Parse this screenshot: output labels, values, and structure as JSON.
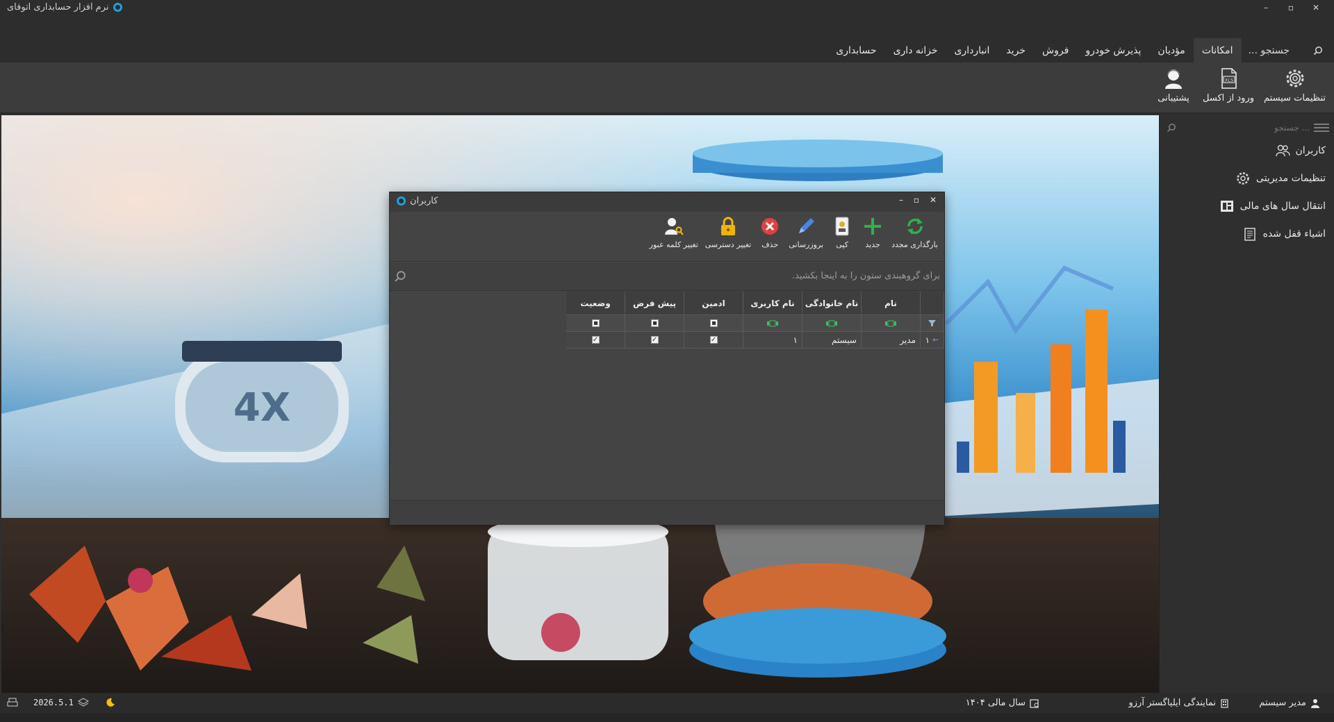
{
  "app": {
    "title": "نرم افزار حسابداری اتوفای"
  },
  "window_controls": {
    "minimize": "–",
    "maximize": "▫",
    "close": "✕"
  },
  "menu": {
    "tabs": [
      "حسابداری",
      "خزانه داری",
      "انبارداری",
      "خرید",
      "فروش",
      "پذیرش خودرو",
      "مؤدیان",
      "امکانات"
    ],
    "active_tab": "امکانات",
    "search_label": "جستجو ..."
  },
  "ribbon": {
    "items": [
      {
        "label": "تنظیمات سیستم",
        "icon": "gear-icon"
      },
      {
        "label": "ورود از اکسل",
        "icon": "excel-file-icon"
      },
      {
        "label": "پشتیبانی",
        "icon": "support-person-icon"
      }
    ]
  },
  "side_panel": {
    "search_placeholder": "... جستجو",
    "items": [
      {
        "label": "کاربران",
        "icon": "users-icon"
      },
      {
        "label": "تنظیمات مدیریتی",
        "icon": "admin-settings-icon"
      },
      {
        "label": "انتقال سال های مالی",
        "icon": "fiscal-year-transfer-icon"
      },
      {
        "label": "اشیاء قفل شده",
        "icon": "locked-objects-icon"
      }
    ]
  },
  "dialog": {
    "title": "کاربران",
    "toolbar": [
      {
        "label": "بارگذاری مجدد",
        "icon": "reload-icon",
        "color": "#2fb04a"
      },
      {
        "label": "جدید",
        "icon": "plus-icon",
        "color": "#33b04a"
      },
      {
        "label": "کپی",
        "icon": "copy-icon",
        "color": "#d8b030"
      },
      {
        "label": "بروزرسانی",
        "icon": "pencil-icon",
        "color": "#4a86e0"
      },
      {
        "label": "حذف",
        "icon": "delete-icon",
        "color": "#e04040"
      },
      {
        "label": "تغییر دسترسی",
        "icon": "lock-icon",
        "color": "#f0b400"
      },
      {
        "label": "تغییر کلمه عبور",
        "icon": "user-key-icon",
        "color": "#f0b400"
      }
    ],
    "group_panel_text": "برای گروهبندی ستون را به اینجا بکشید.",
    "columns": [
      "نام",
      "نام خانوادگی",
      "نام کاربری",
      "ادمین",
      "پیش فرض",
      "وضعیت"
    ],
    "rows": [
      {
        "index": "۱",
        "first_name": "مدیر",
        "last_name": "سیستم",
        "username": "۱",
        "admin": true,
        "default": true,
        "active": true
      }
    ]
  },
  "status": {
    "user": "مدیر سیستم",
    "agency": "نمایندگی ایلیاگستر آرزو",
    "fiscal_year": "سال مالی ۱۴۰۴",
    "version": "2026.5.1"
  }
}
